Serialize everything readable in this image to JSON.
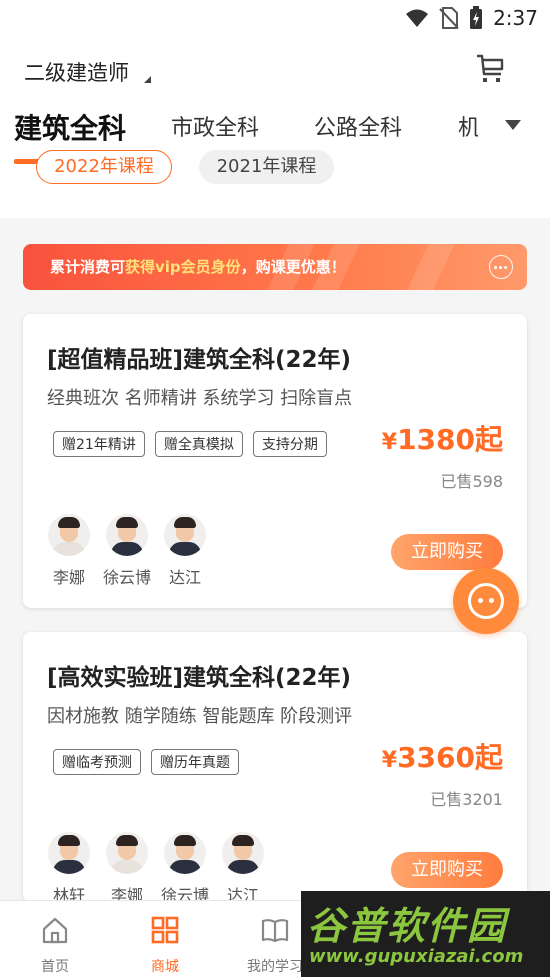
{
  "status_bar": {
    "time": "2:37"
  },
  "header": {
    "exam": "二级建造师"
  },
  "tabs": [
    {
      "label": "建筑全科",
      "active": true
    },
    {
      "label": "市政全科",
      "active": false
    },
    {
      "label": "公路全科",
      "active": false
    },
    {
      "label": "机",
      "active": false
    }
  ],
  "year_filters": [
    {
      "label": "2022年课程",
      "active": true
    },
    {
      "label": "2021年课程",
      "active": false
    }
  ],
  "promo": {
    "text_prefix": "累计消费可",
    "text_highlight": "获得vip会员身份",
    "text_suffix": "，购课更优惠！"
  },
  "courses": [
    {
      "title": "[超值精品班]建筑全科(22年)",
      "subtitle": "经典班次 名师精讲 系统学习 扫除盲点",
      "tags": [
        "赠21年精讲",
        "赠全真模拟",
        "支持分期"
      ],
      "price_symbol": "¥",
      "price": "1380起",
      "sold": "已售598",
      "teachers": [
        "李娜",
        "徐云博",
        "达江"
      ],
      "buy_label": "立即购买"
    },
    {
      "title": "[高效实验班]建筑全科(22年)",
      "subtitle": "因材施教 随学随练 智能题库 阶段测评",
      "tags": [
        "赠临考预测",
        "赠历年真题"
      ],
      "price_symbol": "¥",
      "price": "3360起",
      "sold": "已售3201",
      "teachers": [
        "林轩",
        "李娜",
        "徐云博",
        "达江"
      ],
      "buy_label": "立即购买"
    }
  ],
  "bottom_nav": [
    {
      "label": "首页",
      "icon": "home-icon",
      "active": false
    },
    {
      "label": "商城",
      "icon": "grid-icon",
      "active": true
    },
    {
      "label": "我的学习",
      "icon": "book-icon",
      "active": false
    }
  ],
  "watermark": {
    "title": "谷普软件园",
    "url": "www.gupuxiazai.com"
  },
  "colors": {
    "accent": "#ff6a24",
    "promo_start": "#f9523d",
    "promo_end": "#ff9a6b"
  }
}
